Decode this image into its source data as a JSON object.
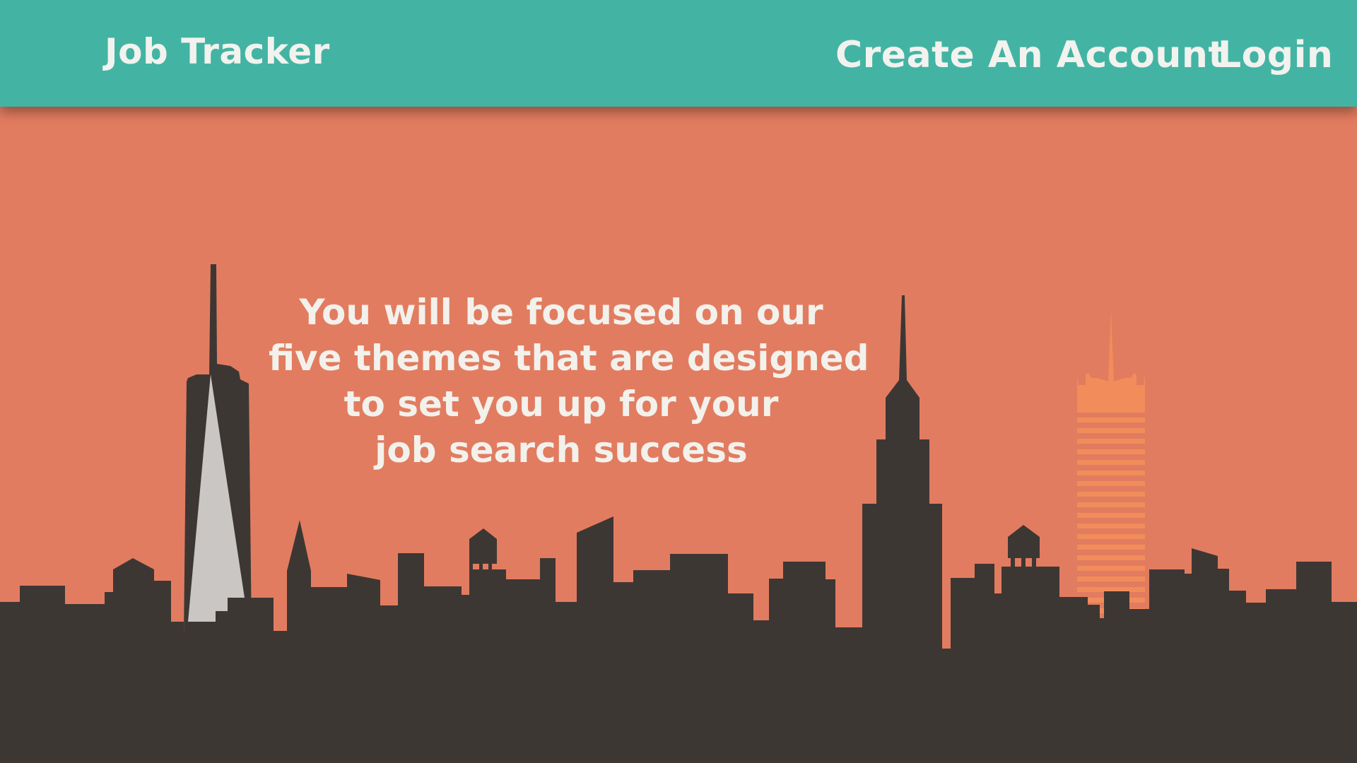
{
  "navbar": {
    "brand": "Job Tracker",
    "links": [
      {
        "label": "Create An Account"
      },
      {
        "label": "Login"
      }
    ]
  },
  "hero": {
    "lines": [
      "You will be focused on our",
      "five themes that are designed",
      "to set you up for your",
      "job search success"
    ]
  },
  "colors": {
    "navbar_bg": "#43b4a3",
    "page_bg": "#e27c60",
    "skyline": "#3d3734",
    "text": "#f3f1ec",
    "accent_building": "#f28c5a"
  }
}
